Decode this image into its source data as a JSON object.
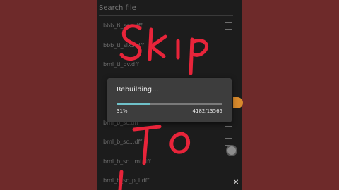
{
  "search": {
    "placeholder": "Search file"
  },
  "files": [
    {
      "name": "bbb_ti_sc...dff"
    },
    {
      "name": "bbb_ti_slx2.dff"
    },
    {
      "name": "bml_ti_ov.dff"
    },
    {
      "name": ""
    },
    {
      "name": ""
    },
    {
      "name": "bml_b_sc.dff"
    },
    {
      "name": "bml_b_sc...dff"
    },
    {
      "name": "bml_b_sc...ml.dff"
    },
    {
      "name": "bml_b_sc_p_l.dff"
    }
  ],
  "dialog": {
    "title": "Rebuilding...",
    "percent_label": "31%",
    "progress_value": 0.31,
    "count_label": "4182/13565"
  },
  "overlay_text": "Skip to",
  "colors": {
    "background": "#6e2a2a",
    "phone": "#1c1c1c",
    "dialog": "#3d3d3d",
    "progress": "#6fc1c9",
    "scribble": "#e8243a"
  },
  "icons": {
    "close": "close-icon"
  },
  "close_glyph": "✕"
}
